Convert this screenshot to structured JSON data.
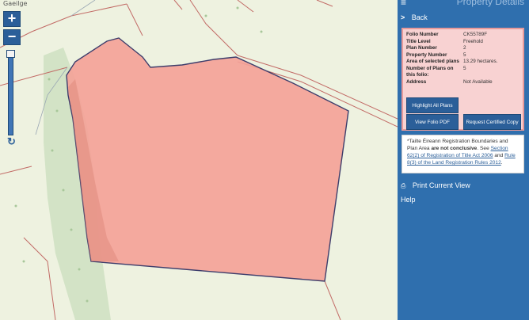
{
  "map": {
    "language_link": "Gaeilge",
    "zoom_in_label": "+",
    "zoom_out_label": "−",
    "refresh_icon": "refresh-icon",
    "colors": {
      "background": "#eef2e0",
      "parcel_fill": "#f4a197",
      "parcel_border": "#3d3d6b",
      "boundary_lines": "#c26b66",
      "woodland": "#cfe0c4"
    }
  },
  "panel": {
    "title": "Property Details",
    "menu_icon": "hamburger-icon",
    "back_label": "Back",
    "back_icon": "chevron-right-icon",
    "details": [
      {
        "label": "Folio Number",
        "value": "CK55789F"
      },
      {
        "label": "Title Level",
        "value": "Freehold"
      },
      {
        "label": "Plan Number",
        "value": "2"
      },
      {
        "label": "Property Number",
        "value": "5"
      },
      {
        "label": "Area of selected plans",
        "value": "13.29 hectares."
      },
      {
        "label": "Number of Plans on this folio:",
        "value": "5"
      },
      {
        "label": "Address",
        "value": "Not Available"
      }
    ],
    "buttons": {
      "highlight_all": "Highlight All Plans",
      "view_folio": "View Folio PDF",
      "request_copy": "Request Certified Copy"
    },
    "disclaimer": {
      "part1": "*Tailte Éireann Registration Boundaries and Plan Area ",
      "bold": "are not conclusive",
      "part2": ". See ",
      "link1": "Section 62(2) of Registration of Title Act 2006",
      "part3": " and ",
      "link2": "Rule 8(3) of the Land Registration Rules 2012",
      "part4": "."
    },
    "print_label": "Print Current View",
    "print_icon": "printer-icon",
    "help_label": "Help",
    "colors": {
      "panel_bg": "#2f6fae",
      "details_bg": "#f8d2d2",
      "details_border": "#e79a9a",
      "button_bg": "#2b5f99"
    }
  }
}
